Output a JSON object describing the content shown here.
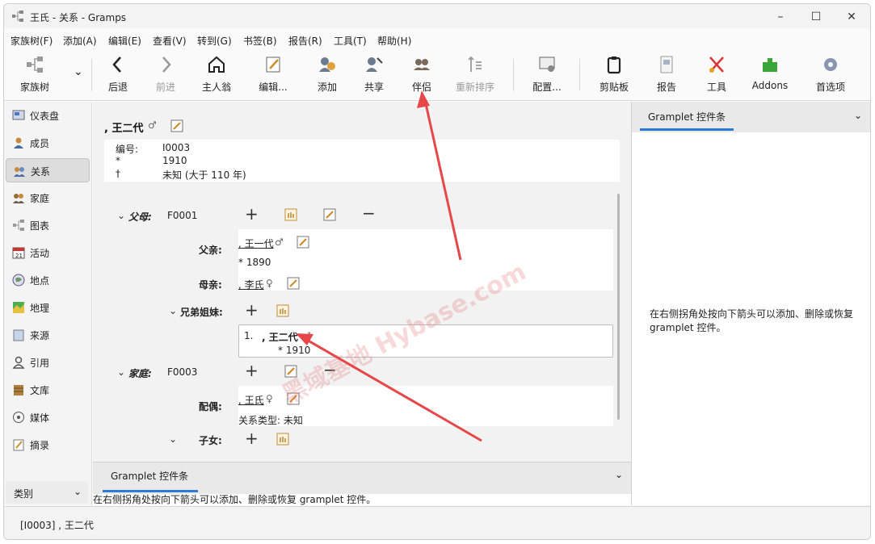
{
  "window": {
    "title": "王氏 - 关系 - Gramps",
    "minimize": "–",
    "maximize": "☐",
    "close": "✕"
  },
  "menu": [
    "家族树(F)",
    "添加(A)",
    "编辑(E)",
    "查看(V)",
    "转到(G)",
    "书签(B)",
    "报告(R)",
    "工具(T)",
    "帮助(H)"
  ],
  "toolbar": [
    {
      "label": "家族树",
      "icon": "family-tree-icon",
      "disabled": false
    },
    {
      "label": "后退",
      "icon": "back-icon",
      "disabled": false
    },
    {
      "label": "前进",
      "icon": "forward-icon",
      "disabled": true
    },
    {
      "label": "主人翁",
      "icon": "home-icon",
      "disabled": false
    },
    {
      "label": "编辑...",
      "icon": "edit-icon",
      "disabled": false
    },
    {
      "label": "添加",
      "icon": "add-person-icon",
      "disabled": false
    },
    {
      "label": "共享",
      "icon": "share-icon",
      "disabled": false
    },
    {
      "label": "伴侣",
      "icon": "partner-icon",
      "disabled": false
    },
    {
      "label": "重新排序",
      "icon": "reorder-icon",
      "disabled": true
    },
    {
      "label": "配置...",
      "icon": "configure-icon",
      "disabled": false
    },
    {
      "label": "剪贴板",
      "icon": "clipboard-icon",
      "disabled": false
    },
    {
      "label": "报告",
      "icon": "report-icon",
      "disabled": false
    },
    {
      "label": "工具",
      "icon": "tools-icon",
      "disabled": false
    },
    {
      "label": "Addons",
      "icon": "addons-icon",
      "disabled": false
    },
    {
      "label": "首选项",
      "icon": "preferences-icon",
      "disabled": false
    }
  ],
  "sidebar": {
    "items": [
      {
        "label": "仪表盘",
        "icon": "dashboard-icon"
      },
      {
        "label": "成员",
        "icon": "people-icon"
      },
      {
        "label": "关系",
        "icon": "relationships-icon",
        "active": true
      },
      {
        "label": "家庭",
        "icon": "family-icon"
      },
      {
        "label": "图表",
        "icon": "charts-icon"
      },
      {
        "label": "活动",
        "icon": "events-icon"
      },
      {
        "label": "地点",
        "icon": "places-icon"
      },
      {
        "label": "地理",
        "icon": "geography-icon"
      },
      {
        "label": "来源",
        "icon": "sources-icon"
      },
      {
        "label": "引用",
        "icon": "citations-icon"
      },
      {
        "label": "文库",
        "icon": "repositories-icon"
      },
      {
        "label": "媒体",
        "icon": "media-icon"
      },
      {
        "label": "摘录",
        "icon": "notes-icon"
      }
    ],
    "category_select": "类别"
  },
  "person": {
    "name": ", 王二代",
    "gender": "♂",
    "info": [
      {
        "key": "编号:",
        "value": "I0003"
      },
      {
        "key": "*",
        "value": "1910"
      },
      {
        "key": "†",
        "value": "未知 (大于 110 年)"
      }
    ]
  },
  "parents": {
    "label": "父母:",
    "id": "F0001",
    "father_role": "父亲:",
    "father_name": ", 王一代",
    "father_gender": "♂",
    "father_birth": "* 1890",
    "mother_role": "母亲:",
    "mother_name": ", 李氏",
    "mother_gender": "♀",
    "siblings_label": "兄弟姐妹:",
    "sibling_index": "1.",
    "sibling_name": ", 王二代",
    "sibling_gender": "♂",
    "sibling_birth": "* 1910"
  },
  "family": {
    "label": "家庭:",
    "id": "F0003",
    "spouse_role": "配偶:",
    "spouse_name": ", 王氏",
    "spouse_gender": "♀",
    "relation_type": "关系类型: 未知",
    "children_label": "子女:"
  },
  "bottom_gramplet": {
    "tab": "Gramplet 控件条",
    "message": "在右侧拐角处按向下箭头可以添加、删除或恢复 gramplet 控件。"
  },
  "right_gramplet": {
    "tab": "Gramplet 控件条",
    "message": "在右侧拐角处按向下箭头可以添加、删除或恢复 gramplet 控件。"
  },
  "status": "[I0003] , 王二代",
  "watermark": "黑域基地 Hybase.com",
  "colors": {
    "accent": "#2c7bd6",
    "arrow": "#e8474a"
  }
}
